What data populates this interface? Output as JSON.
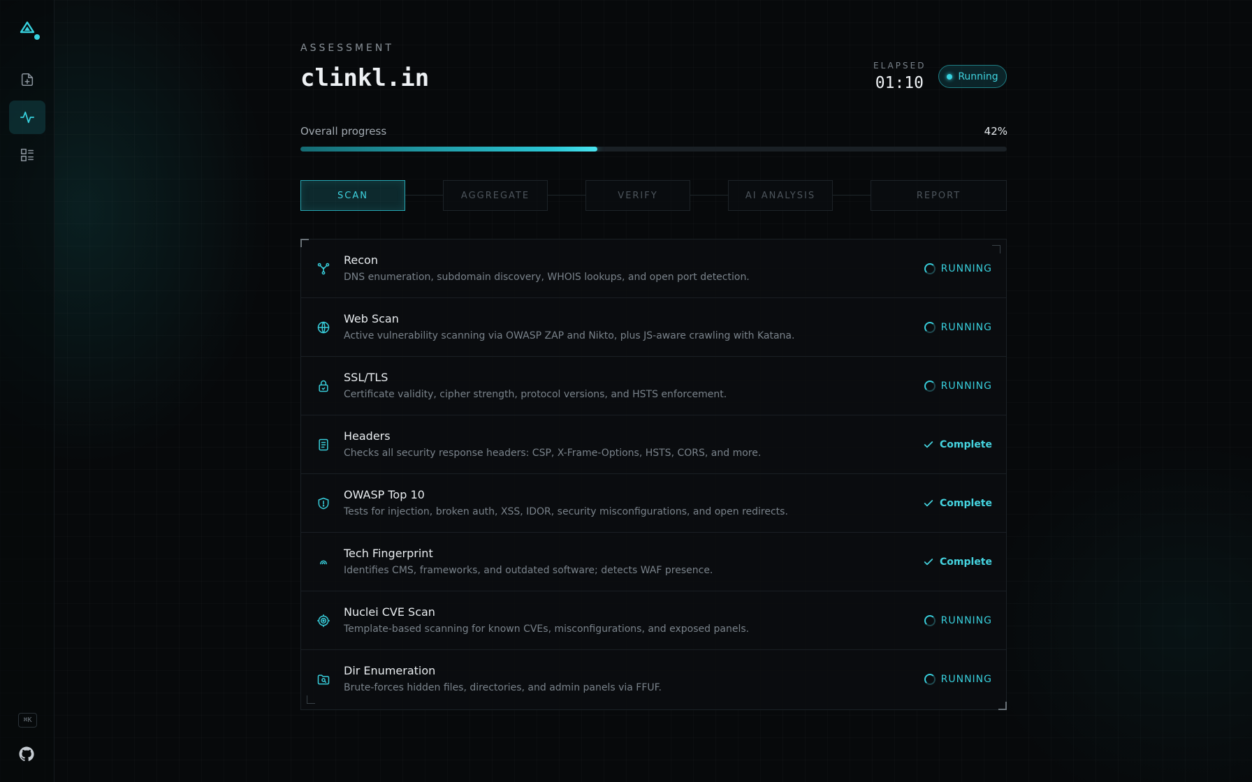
{
  "header": {
    "eyebrow": "ASSESSMENT",
    "target": "clinkl.in",
    "elapsed_label": "ELAPSED",
    "elapsed_value": "01:10",
    "status": "Running"
  },
  "progress": {
    "label": "Overall progress",
    "percent_text": "42%",
    "fraction": 0.42
  },
  "steps": [
    {
      "label": "SCAN",
      "active": true
    },
    {
      "label": "AGGREGATE",
      "active": false
    },
    {
      "label": "VERIFY",
      "active": false
    },
    {
      "label": "AI ANALYSIS",
      "active": false
    },
    {
      "label": "REPORT",
      "active": false
    }
  ],
  "modules": [
    {
      "title": "Recon",
      "desc": "DNS enumeration, subdomain discovery, WHOIS lookups, and open port detection.",
      "status": "RUNNING",
      "icon": "network-icon"
    },
    {
      "title": "Web Scan",
      "desc": "Active vulnerability scanning via OWASP ZAP and Nikto, plus JS-aware crawling with Katana.",
      "status": "RUNNING",
      "icon": "globe-icon"
    },
    {
      "title": "SSL/TLS",
      "desc": "Certificate validity, cipher strength, protocol versions, and HSTS enforcement.",
      "status": "RUNNING",
      "icon": "lock-icon"
    },
    {
      "title": "Headers",
      "desc": "Checks all security response headers: CSP, X-Frame-Options, HSTS, CORS, and more.",
      "status": "Complete",
      "icon": "document-icon"
    },
    {
      "title": "OWASP Top 10",
      "desc": "Tests for injection, broken auth, XSS, IDOR, security misconfigurations, and open redirects.",
      "status": "Complete",
      "icon": "shield-icon"
    },
    {
      "title": "Tech Fingerprint",
      "desc": "Identifies CMS, frameworks, and outdated software; detects WAF presence.",
      "status": "Complete",
      "icon": "fingerprint-icon"
    },
    {
      "title": "Nuclei CVE Scan",
      "desc": "Template-based scanning for known CVEs, misconfigurations, and exposed panels.",
      "status": "RUNNING",
      "icon": "target-icon"
    },
    {
      "title": "Dir Enumeration",
      "desc": "Brute-forces hidden files, directories, and admin panels via FFUF.",
      "status": "RUNNING",
      "icon": "folder-search-icon"
    }
  ],
  "sidebar": {
    "shortcut": "⌘K",
    "icons": [
      "logo-icon",
      "new-scan-icon",
      "activity-icon",
      "list-icon",
      "github-icon"
    ]
  },
  "colors": {
    "accent": "#38d3e0",
    "background": "#07090b"
  }
}
